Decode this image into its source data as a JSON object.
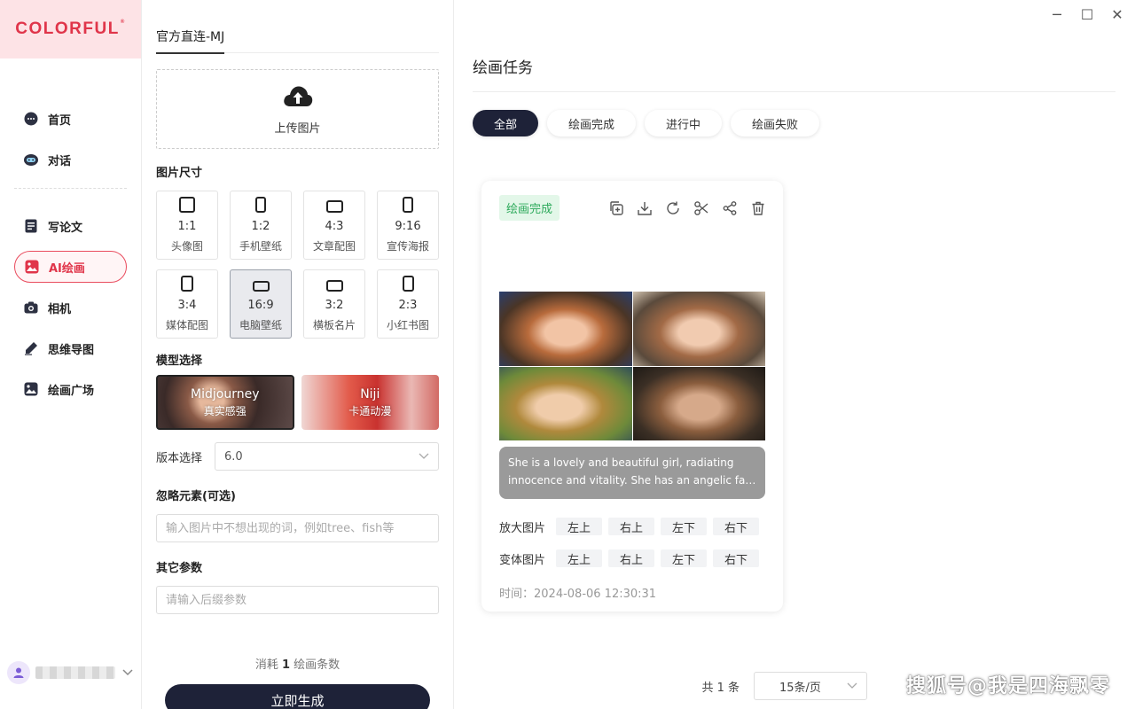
{
  "app": {
    "logo": "COLORFUL",
    "logo_mark": "®"
  },
  "window": {
    "minimize": "─",
    "maximize": "☐",
    "close": "✕"
  },
  "sidebar": {
    "items": [
      {
        "label": "首页",
        "icon": "chat-bubble-icon"
      },
      {
        "label": "对话",
        "icon": "robot-icon"
      },
      {
        "label": "写论文",
        "icon": "document-icon"
      },
      {
        "label": "AI绘画",
        "icon": "image-icon",
        "active": true
      },
      {
        "label": "相机",
        "icon": "camera-icon"
      },
      {
        "label": "思维导图",
        "icon": "pen-icon"
      },
      {
        "label": "绘画广场",
        "icon": "gallery-icon"
      }
    ]
  },
  "config": {
    "tab": "官方直连-MJ",
    "upload_label": "上传图片",
    "size_title": "图片尺寸",
    "sizes": [
      {
        "ratio": "1:1",
        "name": "头像图"
      },
      {
        "ratio": "1:2",
        "name": "手机壁纸"
      },
      {
        "ratio": "4:3",
        "name": "文章配图"
      },
      {
        "ratio": "9:16",
        "name": "宣传海报"
      },
      {
        "ratio": "3:4",
        "name": "媒体配图"
      },
      {
        "ratio": "16:9",
        "name": "电脑壁纸",
        "active": true
      },
      {
        "ratio": "3:2",
        "name": "横板名片"
      },
      {
        "ratio": "2:3",
        "name": "小红书图"
      }
    ],
    "model_title": "模型选择",
    "models": [
      {
        "name": "Midjourney",
        "sub": "真实感强"
      },
      {
        "name": "Niji",
        "sub": "卡通动漫"
      }
    ],
    "version_label": "版本选择",
    "version_value": "6.0",
    "ignore_title": "忽略元素(可选)",
    "ignore_placeholder": "输入图片中不想出现的词，例如tree、fish等",
    "other_title": "其它参数",
    "other_placeholder": "请输入后缀参数",
    "cost_prefix": "消耗",
    "cost_value": "1",
    "cost_suffix": "绘画条数",
    "generate_label": "立即生成"
  },
  "main": {
    "title": "绘画任务",
    "filters": [
      "全部",
      "绘画完成",
      "进行中",
      "绘画失败"
    ],
    "card": {
      "status": "绘画完成",
      "prompt_line1": "She is a lovely and beautiful girl, radiating",
      "prompt_line2": "innocence and vitality. She has an angelic fac...",
      "upscale_label": "放大图片",
      "variation_label": "变体图片",
      "quadrants": [
        "左上",
        "右上",
        "左下",
        "右下"
      ],
      "time": "时间：2024-08-06 12:30:31"
    },
    "pager": {
      "total": "共 1 条",
      "page_size": "15条/页"
    }
  },
  "watermark": "搜狐号@我是四海飘零"
}
